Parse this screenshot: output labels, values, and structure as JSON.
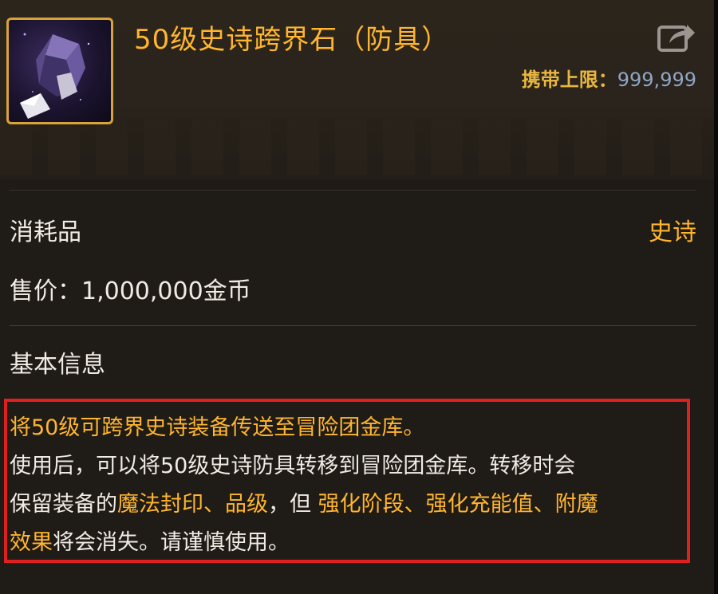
{
  "item": {
    "name": "50级史诗跨界石（防具）",
    "icon": "crystal-stone-icon",
    "carry_limit_label": "携带上限：",
    "carry_limit_value": "999,999",
    "category": "消耗品",
    "rarity": "史诗",
    "price_text": "售价：1,000,000金币"
  },
  "section": {
    "basic_info_title": "基本信息"
  },
  "description": {
    "line1": "将50级可跨界史诗装备传送至冒险团金库。",
    "line2": "使用后，可以将50级史诗防具转移到冒险团金库。转移时会",
    "line3_a": "保留装备的",
    "line3_b": "魔法封印、品级",
    "line3_c": "，但 ",
    "line3_d": "强化阶段、强化充能值、附魔",
    "line4_a": "效果",
    "line4_b": "将会消失。请谨慎使用。"
  },
  "colors": {
    "accent_gold": "#ffb52e",
    "carry_value_blue": "#8fa6c6",
    "highlight_border_red": "#e0201e",
    "icon_border": "#d9a23a"
  }
}
